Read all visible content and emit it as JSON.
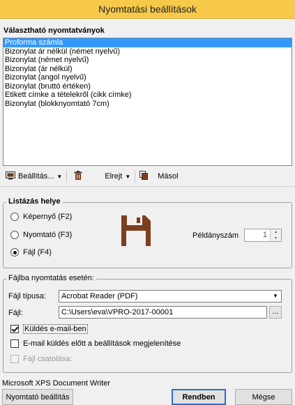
{
  "window": {
    "title": "Nyomtatási beállítások"
  },
  "forms": {
    "label": "Választható nyomtatványok",
    "items": [
      "Proforma számla",
      "Bizonylat ár nélkül (német nyelvű)",
      "Bizonylat (német nyelvű)",
      "Bizonylat (ár nélkül)",
      "Bizonylat (angol nyelvű)",
      "Bizonylat (bruttó értéken)",
      "Etikett címke a tételekről (cikk címke)",
      "Bizonylat (blokknyomtató 7cm)"
    ],
    "selected_index": 0
  },
  "toolbar": {
    "settings_label": "Beállítás...",
    "hide_label": "Elrejt",
    "copy_label": "Másol",
    "icons": [
      "printer-icon",
      "trash-icon",
      "copy-icon"
    ]
  },
  "output": {
    "legend": "Listázás helye",
    "options": [
      "Képernyő (F2)",
      "Nyomtató (F3)",
      "Fájl (F4)"
    ],
    "selected": "Fájl (F4)",
    "copies_label": "Példányszám",
    "copies_value": "1",
    "icon": "floppy-disk-icon",
    "icon_color": "#7b3f1e"
  },
  "file_print": {
    "legend": "Fájlba nyomtatás esetén:",
    "type_label": "Fájl típusa:",
    "type_value": "Acrobat Reader (PDF)",
    "file_label": "Fájl:",
    "file_value": "C:\\Users\\eva\\VPRO-2017-00001",
    "browse_label": "...",
    "send_email_label": "Küldés e-mail-ben",
    "send_email_checked": true,
    "show_settings_label": "E-mail küldés előtt a beállítások megjelenítése",
    "show_settings_checked": false,
    "attach_label": "Fájl csatolása:",
    "attach_checked": false
  },
  "footer": {
    "printer_name": "Microsoft XPS Document Writer",
    "printer_settings_label": "Nyomtató beállítás",
    "ok_label": "Rendben",
    "cancel_label": "Mégse"
  },
  "colors": {
    "title_bar": "#f6c94a",
    "selection": "#3399ff",
    "default_button_border": "#2e6cd4"
  }
}
